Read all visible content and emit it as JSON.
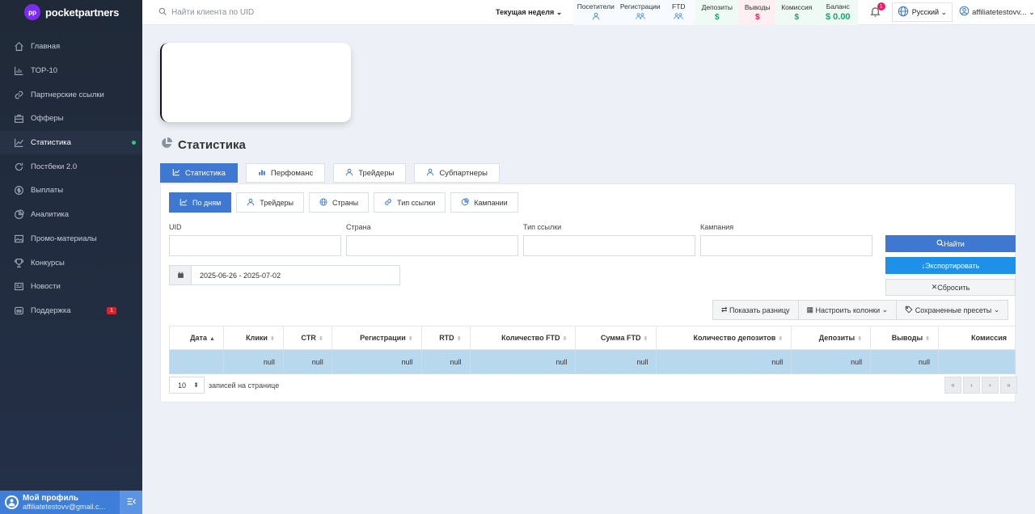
{
  "brand": {
    "name": "pocketpartners"
  },
  "search": {
    "placeholder": "Найти клиента по UID"
  },
  "period": {
    "label": "Текущая неделя"
  },
  "stats": [
    {
      "label": "Посетители",
      "icon": "user-icon"
    },
    {
      "label": "Регистрации",
      "icon": "users-icon"
    },
    {
      "label": "FTD",
      "icon": "users-icon"
    },
    {
      "label": "Депозиты",
      "icon": "dollar-icon",
      "value": "$"
    },
    {
      "label": "Выводы",
      "icon": "dollar-icon",
      "value": "$"
    },
    {
      "label": "Комиссия",
      "icon": "dollar-icon",
      "value": "$"
    },
    {
      "label": "Баланс",
      "value": "$ 0.00"
    }
  ],
  "colors": {
    "accent": "#3e78d0",
    "export": "#1e90ea",
    "green": "#1aa56a",
    "pink": "#e91e63",
    "row": "#b8d8ee"
  },
  "notifications": {
    "count": "1"
  },
  "language": {
    "label": "Русский"
  },
  "user": {
    "name": "affiliatetestovv..."
  },
  "sidebar": {
    "items": [
      {
        "label": "Главная",
        "icon": "home-icon"
      },
      {
        "label": "TOP-10",
        "icon": "bar-chart-icon"
      },
      {
        "label": "Партнерские ссылки",
        "icon": "link-icon"
      },
      {
        "label": "Офферы",
        "icon": "briefcase-icon"
      },
      {
        "label": "Статистика",
        "icon": "line-chart-icon",
        "active": true
      },
      {
        "label": "Постбеки 2.0",
        "icon": "refresh-icon"
      },
      {
        "label": "Выплаты",
        "icon": "coin-icon"
      },
      {
        "label": "Аналитика",
        "icon": "pie-chart-icon"
      },
      {
        "label": "Промо-материалы",
        "icon": "image-icon"
      },
      {
        "label": "Конкурсы",
        "icon": "trophy-icon"
      },
      {
        "label": "Новости",
        "icon": "newspaper-icon"
      },
      {
        "label": "Поддержка",
        "icon": "support-icon",
        "badge": "1"
      }
    ]
  },
  "profile": {
    "title": "Мой профиль",
    "email": "affiliatetestovv@gmail.c..."
  },
  "page": {
    "title": "Статистика"
  },
  "tabs": [
    {
      "label": "Статистика",
      "active": true
    },
    {
      "label": "Перфоманс"
    },
    {
      "label": "Трейдеры"
    },
    {
      "label": "Субпартнеры"
    }
  ],
  "subtabs": [
    {
      "label": "По дням",
      "active": true
    },
    {
      "label": "Трейдеры"
    },
    {
      "label": "Страны"
    },
    {
      "label": "Тип ссылки"
    },
    {
      "label": "Кампании"
    }
  ],
  "filters": {
    "uid": {
      "label": "UID",
      "value": ""
    },
    "country": {
      "label": "Страна",
      "value": ""
    },
    "link_type": {
      "label": "Тип ссылки",
      "value": ""
    },
    "campaign": {
      "label": "Кампания",
      "value": ""
    },
    "date_range": "2025-06-26 - 2025-07-02"
  },
  "actions": {
    "find": "Найти",
    "export": "Экспортировать",
    "reset": "Сбросить"
  },
  "toolbar": {
    "diff": "Показать разницу",
    "columns": "Настроить колонки",
    "presets": "Сохраненные пресеты"
  },
  "table": {
    "columns": [
      "Дата",
      "Клики",
      "CTR",
      "Регистрации",
      "RTD",
      "Количество FTD",
      "Сумма FTD",
      "Количество депозитов",
      "Депозиты",
      "Выводы",
      "Комиссия"
    ],
    "rows": [
      [
        "",
        "null",
        "null",
        "null",
        "null",
        "null",
        "null",
        "null",
        "null",
        "null",
        ""
      ]
    ]
  },
  "pagination": {
    "per_page": "10",
    "per_page_label": "записей на странице",
    "buttons": [
      "«",
      "‹",
      "›",
      "»"
    ]
  }
}
